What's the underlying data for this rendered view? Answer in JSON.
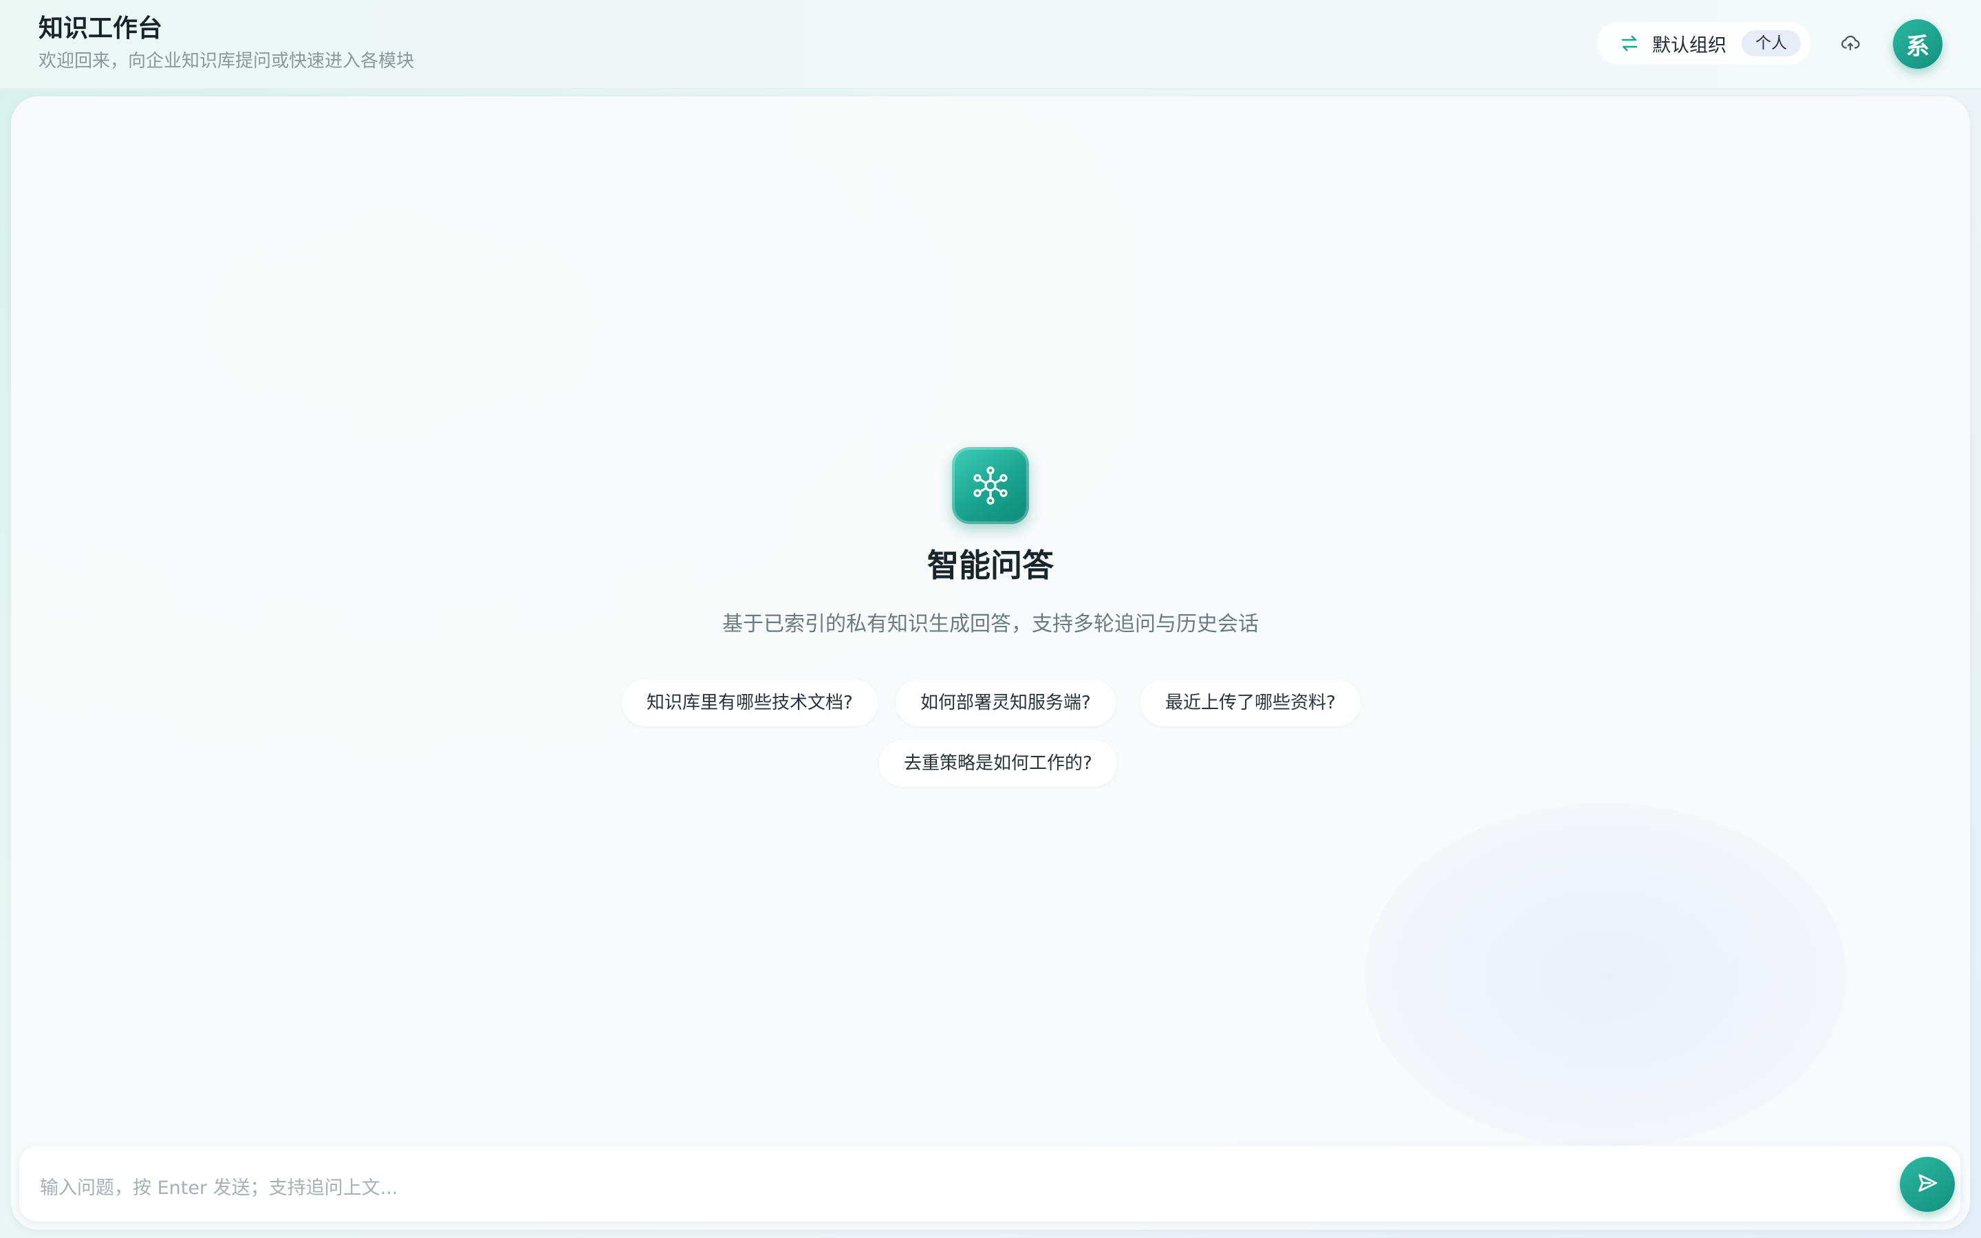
{
  "header": {
    "title": "知识工作台",
    "subtitle": "欢迎回来，向企业知识库提问或快速进入各模块",
    "org_switch": {
      "icon": "swap-arrows-icon",
      "name": "默认组织",
      "badge": "个人"
    },
    "cloud_icon": "cloud-upload-icon",
    "avatar_text": "系"
  },
  "hero": {
    "icon": "network-hub-icon",
    "title": "智能问答",
    "description": "基于已索引的私有知识生成回答，支持多轮追问与历史会话"
  },
  "suggestions": [
    "知识库里有哪些技术文档?",
    "如何部署灵知服务端?",
    "最近上传了哪些资料?",
    "去重策略是如何工作的?"
  ],
  "input": {
    "value": "",
    "placeholder": "输入问题，按 Enter 发送；支持追问上文...",
    "send_icon": "send-icon"
  },
  "colors": {
    "accent": "#1aa58f",
    "accent_dark": "#14907f"
  }
}
